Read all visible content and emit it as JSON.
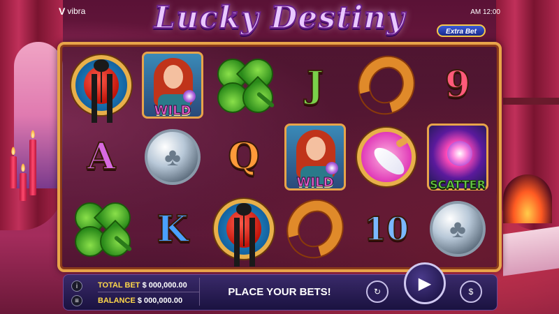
{
  "header": {
    "logo_text": "vibra",
    "logo_mark": "V",
    "title": "Lucky Destiny",
    "time": "AM 12:00",
    "extra_bet_label": "Extra Bet"
  },
  "reels": {
    "rows": [
      [
        {
          "symbol": "ladybug",
          "kind": "medal-icon"
        },
        {
          "symbol": "wild",
          "label": "WILD"
        },
        {
          "symbol": "clover",
          "kind": "icon"
        },
        {
          "symbol": "letter",
          "text": "J"
        },
        {
          "symbol": "horseshoe",
          "kind": "icon"
        },
        {
          "symbol": "letter",
          "text": "9"
        }
      ],
      [
        {
          "symbol": "letter",
          "text": "A"
        },
        {
          "symbol": "coin",
          "kind": "icon"
        },
        {
          "symbol": "letter",
          "text": "Q"
        },
        {
          "symbol": "wild",
          "label": "WILD"
        },
        {
          "symbol": "quill",
          "kind": "medal-icon"
        },
        {
          "symbol": "scatter",
          "label": "SCATTER"
        }
      ],
      [
        {
          "symbol": "clover",
          "kind": "icon"
        },
        {
          "symbol": "letter",
          "text": "K"
        },
        {
          "symbol": "ladybug",
          "kind": "medal-icon"
        },
        {
          "symbol": "horseshoe",
          "kind": "icon"
        },
        {
          "symbol": "letter",
          "text": "10"
        },
        {
          "symbol": "coin",
          "kind": "icon"
        }
      ]
    ]
  },
  "bottom_bar": {
    "total_bet_label": "TOTAL BET",
    "total_bet_value": "$ 000,000.00",
    "balance_label": "BALANCE",
    "balance_value": "$ 000,000.00",
    "message": "PLACE YOUR BETS!",
    "info_icon": "i",
    "menu_icon": "≡",
    "autoplay_icon": "↻",
    "spin_icon": "▶",
    "bet_icon": "$"
  },
  "colors": {
    "frame_gold": "#e8a44a",
    "bar_bg": "#1a1240",
    "bet_label": "#ffd84a"
  }
}
